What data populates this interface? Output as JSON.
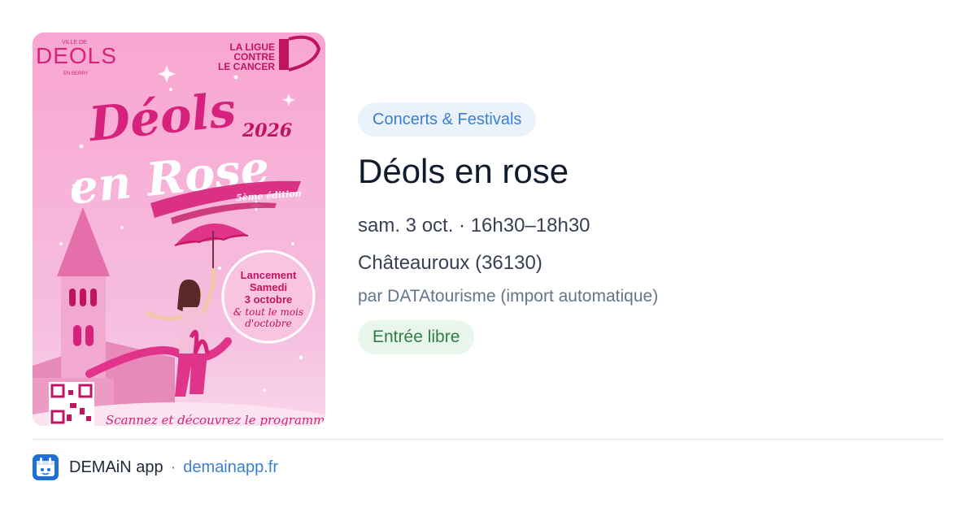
{
  "event": {
    "category": "Concerts & Festivals",
    "title": "Déols en rose",
    "datetime": "sam. 3 oct. · 16h30–18h30",
    "location": "Châteauroux (36130)",
    "organizer": "par DATAtourisme (import automatique)",
    "price": "Entrée libre"
  },
  "poster": {
    "town_logo": "DEOLS",
    "town_arc_top": "VILLE DE",
    "town_arc_bottom": "EN BERRY",
    "league_line1": "LA LIGUE",
    "league_line2": "CONTRE",
    "league_line3": "LE CANCER",
    "headline_line1": "Déols",
    "headline_line2": "en Rose",
    "year": "2026",
    "edition": "5ème édition",
    "launch_line1": "Lancement",
    "launch_line2": "Samedi",
    "launch_line3": "3 octobre",
    "launch_line4": "& tout le mois",
    "launch_line5": "d'octobre",
    "footer_text": "Scannez et découvrez le programme"
  },
  "footer": {
    "app_name": "DEMAiN app",
    "separator": "·",
    "domain": "demainapp.fr"
  },
  "colors": {
    "chip_bg": "#eaf2fb",
    "chip_text": "#3b7fd1",
    "price_bg": "#e8f6ec",
    "price_text": "#2f7d47",
    "poster_pink": "#f7b3d8",
    "poster_magenta": "#d6227c"
  },
  "icons": {
    "app": "demain-app-icon"
  }
}
